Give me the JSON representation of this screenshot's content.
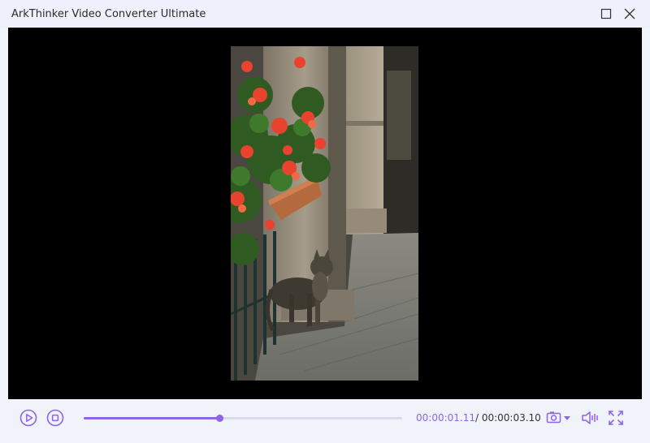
{
  "window": {
    "title": "ArkThinker Video Converter Ultimate"
  },
  "player": {
    "current_time": "00:00:01.11",
    "total_time": "/ 00:00:03.10",
    "progress": 0.427
  },
  "colors": {
    "accent": "#8d63ee",
    "titlebar_bg": "#eef0fb",
    "video_bg": "#000000"
  },
  "icons": {
    "maximize": "maximize-icon",
    "close": "close-icon",
    "play": "play-icon",
    "stop": "stop-icon",
    "snapshot": "camera-icon",
    "volume": "speaker-icon",
    "fullscreen": "fullscreen-icon"
  }
}
